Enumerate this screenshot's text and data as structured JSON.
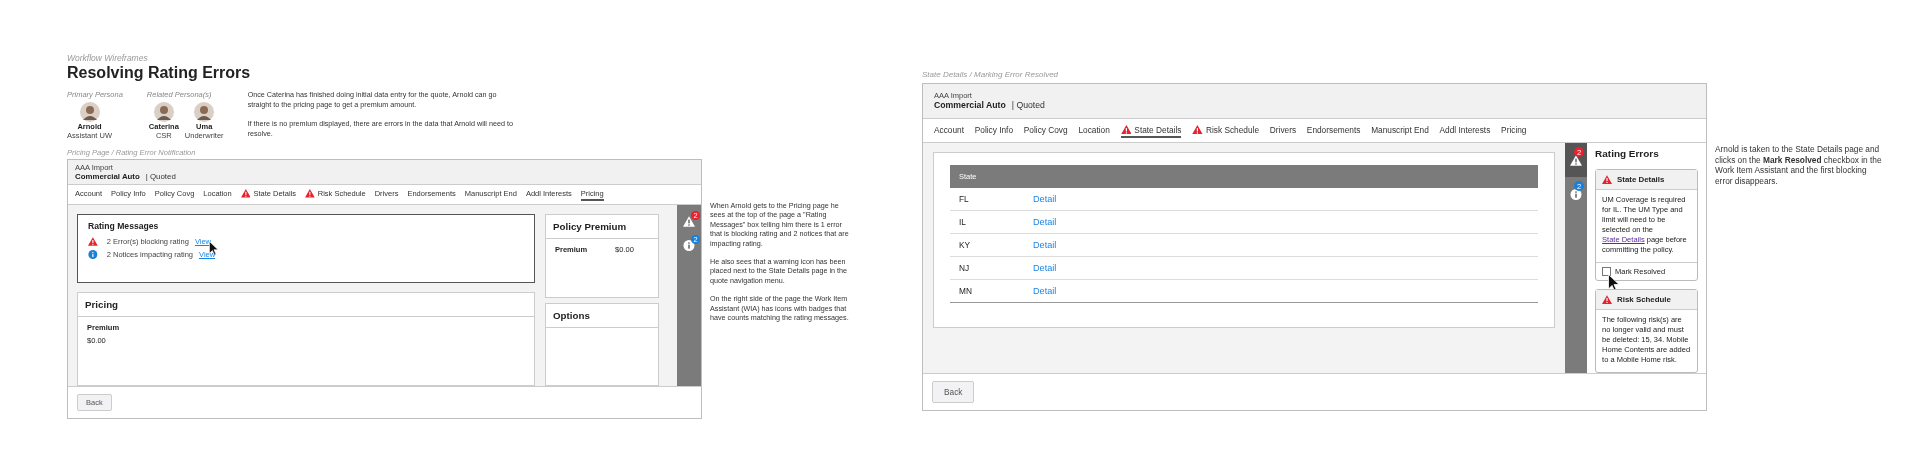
{
  "header": {
    "eyebrow": "Workflow Wireframes",
    "title": "Resolving Rating Errors"
  },
  "personas": {
    "primary_label": "Primary Persona",
    "primary": [
      {
        "name": "Arnold",
        "role": "Assistant UW"
      }
    ],
    "related_label": "Related Persona(s)",
    "related": [
      {
        "name": "Caterina",
        "role": "CSR"
      },
      {
        "name": "Uma",
        "role": "Underwriter"
      }
    ]
  },
  "intro": [
    "Once Caterina has finished doing initial data entry for the quote, Arnold can go straight to the pricing page to get a premium amount.",
    "If there is no premium displayed, there are errors in the data that Arnold will need to resolve."
  ],
  "screens": [
    {
      "kind": "pricing",
      "caption": "Pricing Page / Rating Error Notification",
      "policy": {
        "account": "AAA Import",
        "product": "Commercial Auto",
        "status": "| Quoted"
      },
      "nav": [
        {
          "label": "Account",
          "warning": false,
          "selected": false
        },
        {
          "label": "Policy Info",
          "warning": false,
          "selected": false
        },
        {
          "label": "Policy Covg",
          "warning": false,
          "selected": false
        },
        {
          "label": "Location",
          "warning": false,
          "selected": false
        },
        {
          "label": "State Details",
          "warning": true,
          "selected": false
        },
        {
          "label": "Risk Schedule",
          "warning": true,
          "selected": false
        },
        {
          "label": "Drivers",
          "warning": false,
          "selected": false
        },
        {
          "label": "Endorsements",
          "warning": false,
          "selected": false
        },
        {
          "label": "Manuscript End",
          "warning": false,
          "selected": false
        },
        {
          "label": "Addl Interests",
          "warning": false,
          "selected": false
        },
        {
          "label": "Pricing",
          "warning": false,
          "selected": true
        }
      ],
      "rating_messages": {
        "title": "Rating Messages",
        "items": [
          {
            "kind": "error",
            "text": "2 Error(s) blocking rating",
            "link": "View"
          },
          {
            "kind": "info",
            "text": "2 Notices impacting rating",
            "link": "View"
          }
        ]
      },
      "pricing": {
        "title": "Pricing",
        "label": "Premium",
        "value": "$0.00"
      },
      "policy_premium": {
        "title": "Policy Premium",
        "label": "Premium",
        "value": "$0.00"
      },
      "options": {
        "title": "Options"
      },
      "wia": [
        {
          "kind": "warning",
          "badge": "2",
          "selected": false
        },
        {
          "kind": "info",
          "badge": "2",
          "selected": false
        }
      ],
      "back": "Back",
      "notes": [
        "When Arnold gets to the Pricing page he sees at the top of the page a \"Rating Messages\" box telling him there is 1 error that is blocking rating and 2 notices that are impacting rating.",
        "He also sees that a warning icon has been placed next to the State Details page in the quote navigation menu.",
        "On the right side of the page the Work Item Assistant (WIA) has icons with badges that have counts matching the rating messages."
      ]
    },
    {
      "kind": "state_details",
      "caption": "State Details / Marking Error Resolved",
      "policy": {
        "account": "AAA Import",
        "product": "Commercial Auto",
        "status": "| Quoted"
      },
      "nav": [
        {
          "label": "Account",
          "warning": false,
          "selected": false
        },
        {
          "label": "Policy Info",
          "warning": false,
          "selected": false
        },
        {
          "label": "Policy Covg",
          "warning": false,
          "selected": false
        },
        {
          "label": "Location",
          "warning": false,
          "selected": false
        },
        {
          "label": "State Details",
          "warning": true,
          "selected": true
        },
        {
          "label": "Risk Schedule",
          "warning": true,
          "selected": false
        },
        {
          "label": "Drivers",
          "warning": false,
          "selected": false
        },
        {
          "label": "Endorsements",
          "warning": false,
          "selected": false
        },
        {
          "label": "Manuscript End",
          "warning": false,
          "selected": false
        },
        {
          "label": "Addl Interests",
          "warning": false,
          "selected": false
        },
        {
          "label": "Pricing",
          "warning": false,
          "selected": false
        }
      ],
      "table": {
        "columns": [
          "State"
        ],
        "rows": [
          {
            "state": "FL",
            "link": "Detail"
          },
          {
            "state": "IL",
            "link": "Detail"
          },
          {
            "state": "KY",
            "link": "Detail"
          },
          {
            "state": "NJ",
            "link": "Detail"
          },
          {
            "state": "MN",
            "link": "Detail"
          }
        ]
      },
      "wia": [
        {
          "kind": "warning",
          "badge": "2",
          "selected": true
        },
        {
          "kind": "info",
          "badge": "2",
          "selected": false
        }
      ],
      "panel_title": "Rating Errors",
      "errors": [
        {
          "title": "State Details",
          "text_before": "UM Coverage is required for IL. The UM Type and limit will need to be selected on the",
          "link": "State Details",
          "text_after": "page before committing the policy.",
          "checkbox": {
            "label": "Mark Resolved",
            "checked": false
          }
        },
        {
          "title": "Risk Schedule",
          "text_before": "The following risk(s) are no longer valid and must be deleted: 15, 34. Mobile Home Contents are added to a Mobile Home risk."
        }
      ],
      "back": "Back",
      "notes": [
        "Arnold is taken to the State Details page and clicks on the **Mark Resolved** checkbox in the Work Item Assistant and the first blocking error disappears."
      ]
    }
  ]
}
